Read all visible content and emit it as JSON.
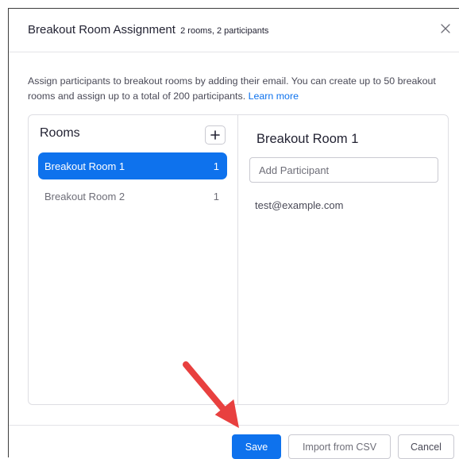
{
  "dialog": {
    "title": "Breakout Room Assignment",
    "subtitle": "2 rooms, 2 participants",
    "description": "Assign participants to breakout rooms by adding their email. You can create up to 50 breakout rooms and assign up to a total of 200 participants.",
    "learn_more": "Learn more",
    "close_icon": "close-icon"
  },
  "rooms_panel": {
    "heading": "Rooms",
    "add_icon": "plus-icon",
    "rooms": [
      {
        "name": "Breakout Room 1",
        "count": "1",
        "selected": true
      },
      {
        "name": "Breakout Room 2",
        "count": "1",
        "selected": false
      }
    ]
  },
  "room_detail": {
    "title": "Breakout Room 1",
    "add_participant_placeholder": "Add Participant",
    "add_participant_value": "",
    "participants": [
      "test@example.com"
    ]
  },
  "footer": {
    "save_label": "Save",
    "import_label": "Import from CSV",
    "cancel_label": "Cancel"
  },
  "annotation": {
    "arrow_color": "#e8403f",
    "arrow_target": "save-button"
  },
  "colors": {
    "accent": "#0e72ed",
    "text": "#232333",
    "muted": "#6e6e78",
    "border": "#dedee3"
  }
}
